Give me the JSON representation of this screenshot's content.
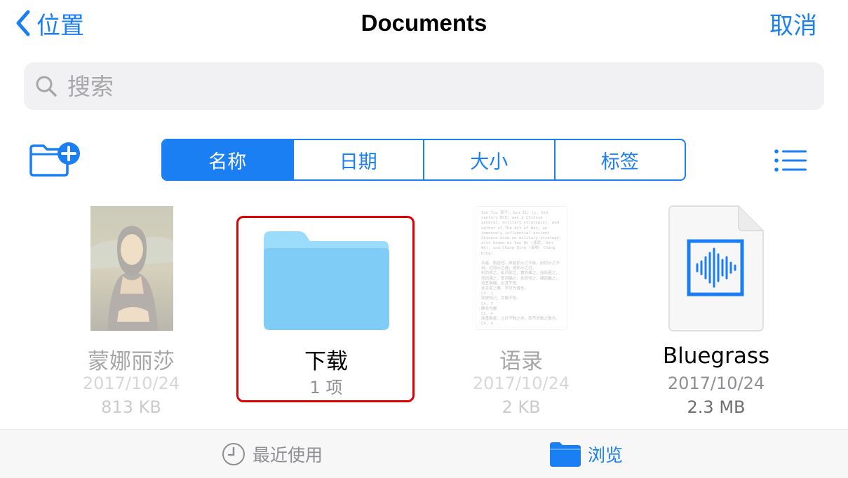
{
  "nav": {
    "back_label": "位置",
    "title": "Documents",
    "cancel_label": "取消"
  },
  "search": {
    "placeholder": "搜索"
  },
  "sort": {
    "segments": [
      "名称",
      "日期",
      "大小",
      "标签"
    ],
    "selected": "名称"
  },
  "files": [
    {
      "name": "蒙娜丽莎",
      "date": "2017/10/24",
      "size": "813 KB",
      "kind": "image",
      "enabled": false
    },
    {
      "name": "下载",
      "detail": "1 项",
      "kind": "folder",
      "enabled": true,
      "highlighted": true
    },
    {
      "name": "语录",
      "date": "2017/10/24",
      "size": "2 KB",
      "kind": "text",
      "enabled": false,
      "preview_text": "Sun Tzu 孫子; Sun Zǐ; (c. 6th century BCE) was a Chinese general, military strategist, and author of The Art of War, an immensely influential ancient Chinese book on military strategy; also known as Sun Wu (孫武; Sūn Wǔ), and Chang Qing (長卿; Cháng Qīng).\n\n兵者，詭道也。故能而示之不能，用而示之不用，近而示之遠，遠而示之近。\n利而誘之，亂而取之，實而備之，強而避之，怒而撓之，卑而驕之，佚而勞之，親而離之，攻其無備，出其不意。\n此兵家之勝，不可先傳也。\nCh. 1\n知彼知己，百戰不殆。\nCh. 3\n勝兵先勝\nCh. 4\n故善戰者，立於不敗之地，而不失敵之敗也。\nCh. 4"
    },
    {
      "name": "Bluegrass",
      "date": "2017/10/24",
      "size": "2.3 MB",
      "kind": "audio",
      "enabled": true
    }
  ],
  "tabbar": {
    "recent_label": "最近使用",
    "browse_label": "浏览",
    "active": "浏览"
  },
  "colors": {
    "accent": "#1a7ff2",
    "folder": "#7fcdf7",
    "highlight": "#e00000"
  }
}
